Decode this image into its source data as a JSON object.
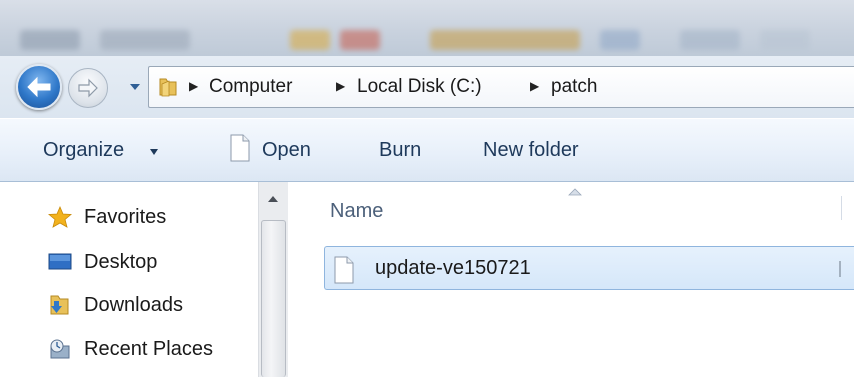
{
  "breadcrumb": {
    "items": [
      "Computer",
      "Local Disk (C:)",
      "patch"
    ]
  },
  "toolbar": {
    "organize_label": "Organize",
    "open_label": "Open",
    "burn_label": "Burn",
    "new_folder_label": "New folder"
  },
  "navigation": {
    "items": [
      {
        "label": "Favorites",
        "icon": "star-icon"
      },
      {
        "label": "Desktop",
        "icon": "desktop-icon"
      },
      {
        "label": "Downloads",
        "icon": "downloads-icon"
      },
      {
        "label": "Recent Places",
        "icon": "recent-places-icon"
      }
    ]
  },
  "file_list": {
    "column_name": "Name",
    "files": [
      {
        "name": "update-ve150721",
        "selected": true
      }
    ]
  },
  "colors": {
    "accent": "#2f78c9",
    "selection": "#d5e7fa",
    "command_text": "#1e395b"
  }
}
